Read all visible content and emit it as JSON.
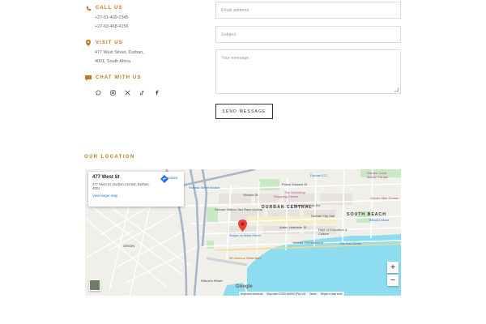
{
  "contact": {
    "call": {
      "title": "CALL US",
      "icon": "phone-icon",
      "lines": [
        "+27-61-409-2345",
        "+27-63-468-4156"
      ]
    },
    "visit": {
      "title": "VISIT US",
      "icon": "location-pin-icon",
      "lines": [
        "477 West Street, Durban,",
        "4001, South Africa"
      ]
    },
    "chat": {
      "title": "CHAT WITH US",
      "icon": "chat-bubble-icon",
      "socials": [
        "whatsapp-icon",
        "instagram-icon",
        "x-icon",
        "tiktok-icon",
        "facebook-icon"
      ]
    }
  },
  "form": {
    "email_placeholder": "Email address",
    "subject_placeholder": "Subject",
    "message_placeholder": "Your message",
    "send_label": "SEND MESSAGE"
  },
  "location": {
    "title": "OUR LOCATION",
    "card": {
      "title": "477 West St",
      "address": "477 West St, Durban Central, Durban, 4001",
      "larger_map": "View larger map",
      "directions": "Directions"
    },
    "map_labels": {
      "victoria_street_market": "Victoria Street Market",
      "victoria_st": "Victoria St",
      "prince_edward_st": "Prince Edward St",
      "workshop": "The Workshop",
      "shopping_centre": "Shopping Centre",
      "durban_icc": "Durban ICC",
      "garden_court": "Garden Court",
      "marine_parade": "Marine Parade",
      "durban_central": "DURBAN CENTRAL",
      "south_beach": "SOUTH BEACH",
      "monty_naicker": "Monty Naicker Rd",
      "durban_city_hall": "Durban City Hall",
      "golden_mile": "Golden Mile Durban",
      "tekweni": "Tekweni Moos",
      "taxi_rank": "Durban Station Taxi Rank Durban",
      "shops_west": "Shops on West Street",
      "anton_lembede": "Anton Lembede St",
      "education": "Dept of Education & Culture",
      "victoria_embankment": "Victoria Embankment",
      "bat_centre": "The Bat Centre",
      "waterfront": "9th Avenue Waterfront",
      "wilsons_wharf": "Wilson's Wharf",
      "origin": "ORIGIN",
      "keyboard": "Keyboard shortcuts",
      "map_data": "Map data ©2025 AfriGIS (Pty) Ltd",
      "terms": "Terms",
      "report": "Report a map error",
      "google": "Google"
    },
    "zoom_in": "+",
    "zoom_out": "−"
  },
  "colors": {
    "accent": "#c07a22",
    "water": "#8edcf0",
    "pin": "#ea4335",
    "link": "#1a73e8"
  }
}
